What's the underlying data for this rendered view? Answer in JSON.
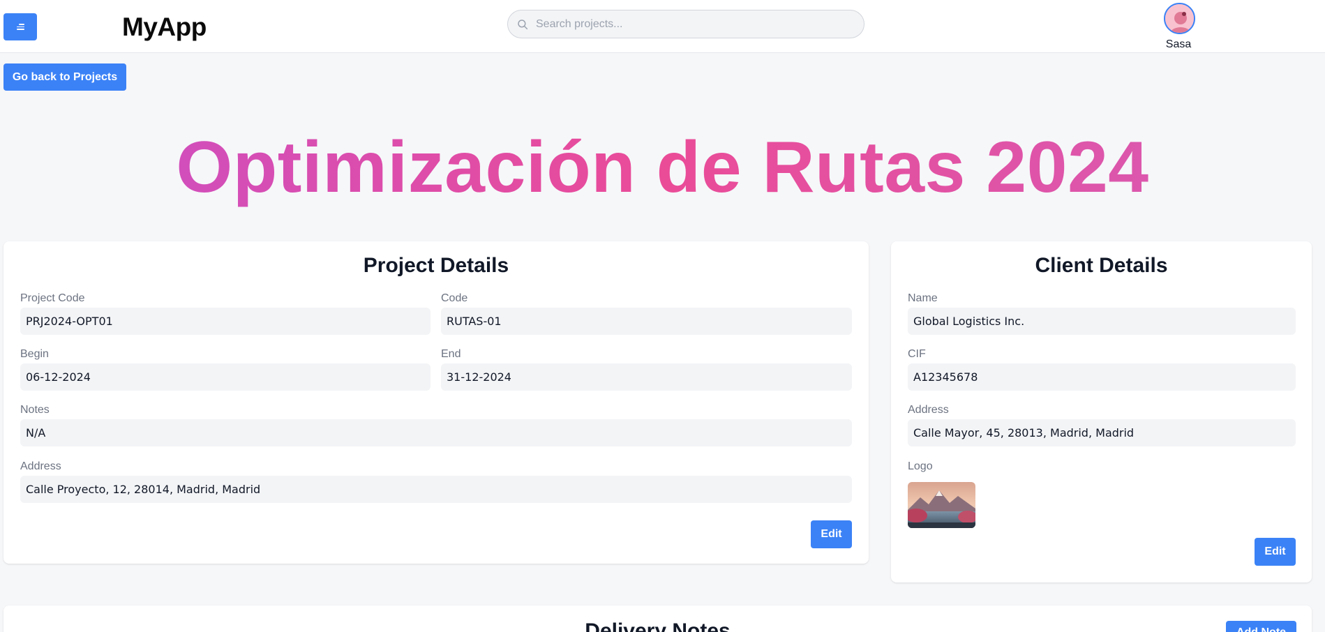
{
  "header": {
    "brand": "MyApp",
    "search_placeholder": "Search projects...",
    "username": "Sasa"
  },
  "nav": {
    "back_label": "Go back to Projects"
  },
  "project": {
    "title": "Optimización de Rutas 2024"
  },
  "project_details": {
    "title": "Project Details",
    "fields": {
      "project_code": {
        "label": "Project Code",
        "value": "PRJ2024-OPT01"
      },
      "code": {
        "label": "Code",
        "value": "RUTAS-01"
      },
      "begin": {
        "label": "Begin",
        "value": "06-12-2024"
      },
      "end": {
        "label": "End",
        "value": "31-12-2024"
      },
      "notes": {
        "label": "Notes",
        "value": "N/A"
      },
      "address": {
        "label": "Address",
        "value": "Calle Proyecto, 12, 28014, Madrid, Madrid"
      }
    },
    "edit_label": "Edit"
  },
  "client_details": {
    "title": "Client Details",
    "fields": {
      "name": {
        "label": "Name",
        "value": "Global Logistics Inc."
      },
      "cif": {
        "label": "CIF",
        "value": "A12345678"
      },
      "address": {
        "label": "Address",
        "value": "Calle Mayor, 45, 28013, Madrid, Madrid"
      },
      "logo": {
        "label": "Logo"
      }
    },
    "edit_label": "Edit"
  },
  "delivery_notes": {
    "title": "Delivery Notes",
    "add_label": "Add Note"
  },
  "colors": {
    "primary": "#3b82f6",
    "title_gradient_start": "#c94fc7",
    "title_gradient_mid": "#ea4c98",
    "title_gradient_end": "#d65bb5"
  }
}
